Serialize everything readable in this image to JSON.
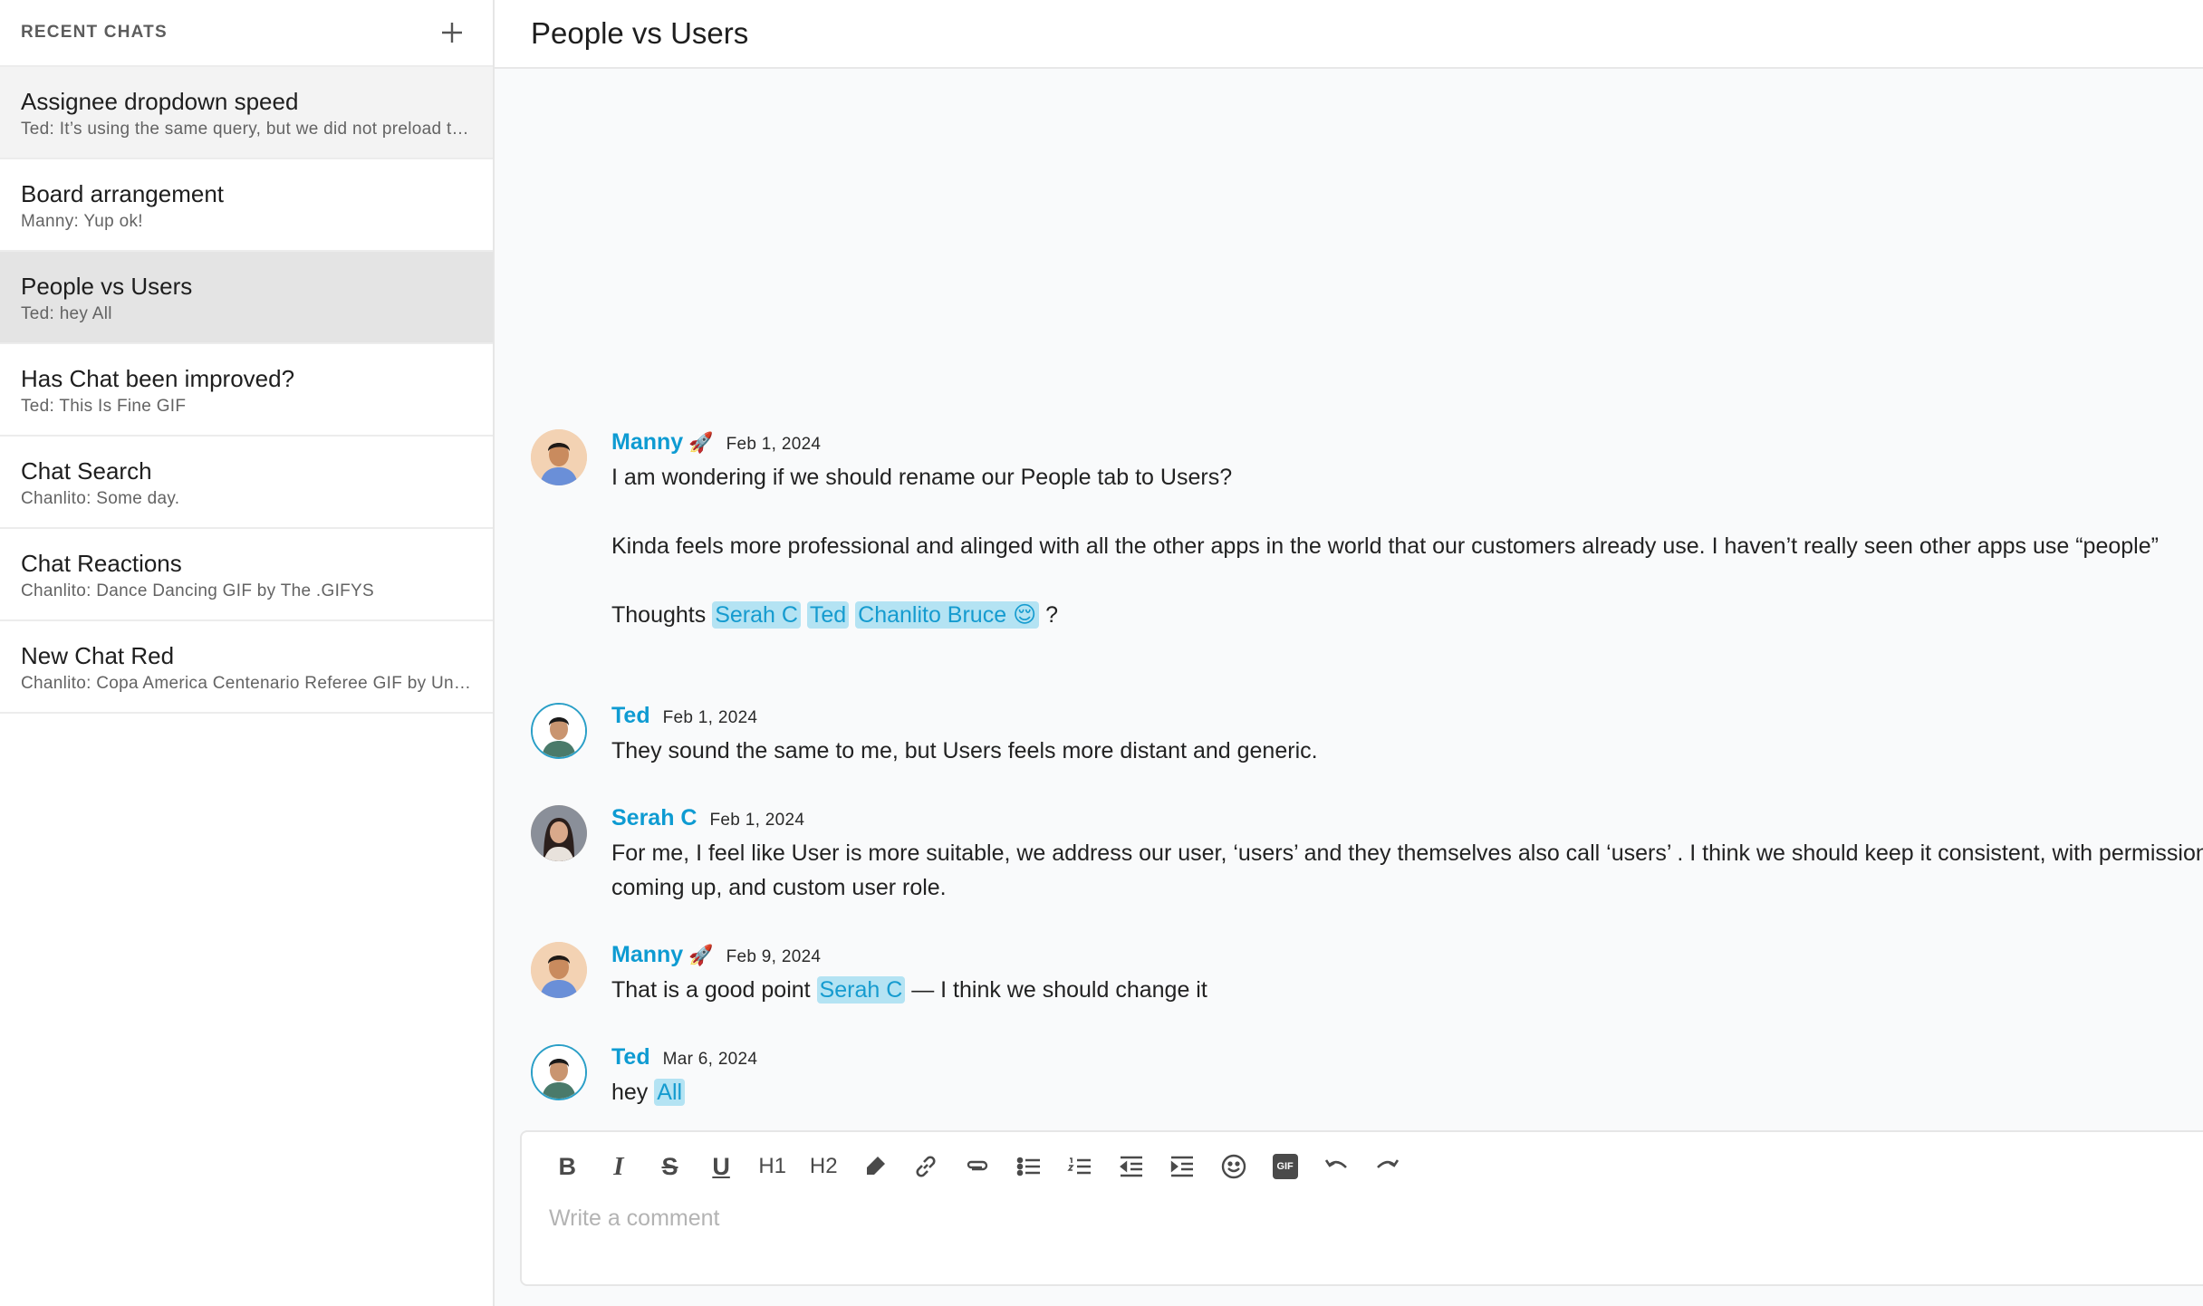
{
  "sidebar": {
    "title": "RECENT CHATS",
    "add_icon": "plus-icon",
    "chats": [
      {
        "name": "Assignee dropdown speed",
        "preview": "Ted: It’s using the same query, but we did not preload the data"
      },
      {
        "name": "Board arrangement",
        "preview": "Manny: Yup ok!"
      },
      {
        "name": "People vs Users",
        "preview": "Ted: hey All"
      },
      {
        "name": "Has Chat been improved?",
        "preview": "Ted: This Is Fine GIF"
      },
      {
        "name": "Chat Search",
        "preview": "Chanlito: Some day."
      },
      {
        "name": "Chat Reactions",
        "preview": "Chanlito: Dance Dancing GIF by The .GIFYS"
      },
      {
        "name": "New Chat Red",
        "preview": "Chanlito: Copa America Centenario Referee GIF by Univision Deportes"
      }
    ],
    "active_index": 2,
    "hover_index": 0
  },
  "header": {
    "title": "People vs Users"
  },
  "messages": [
    {
      "author": "Manny",
      "emoji": "🚀",
      "date": "Feb 1, 2024",
      "line1": "I am wondering if we should rename our People tab to Users?",
      "line2": "Kinda feels more professional and alinged with all the other apps in the world that our customers already use. I haven’t really seen other apps use “people”",
      "line3_prefix": "Thoughts",
      "mentions": [
        "Serah C",
        "Ted",
        "Chanlito Bruce 😌"
      ],
      "line3_suffix": "?"
    },
    {
      "author": "Ted",
      "date": "Feb 1, 2024",
      "line1": "They sound the same to me, but Users feels more distant and generic."
    },
    {
      "author": "Serah C",
      "date": "Feb 1, 2024",
      "line1": "For me, I feel like User is more suitable, we address our user, ‘users’ and they themselves also call ‘users’ . I think we should keep it consistent, with permissions",
      "line2": "coming up, and custom user role."
    },
    {
      "author": "Manny",
      "emoji": "🚀",
      "date": "Feb 9, 2024",
      "prefix": "That is a good point",
      "mention": "Serah C",
      "suffix": "— I think we should change it"
    },
    {
      "author": "Ted",
      "date": "Mar 6, 2024",
      "prefix": "hey",
      "mention": "All"
    }
  ],
  "editor": {
    "placeholder": "Write a comment",
    "value": "",
    "toolbar": [
      {
        "icon": "bold-icon",
        "label": "B"
      },
      {
        "icon": "italic-icon",
        "label": "I"
      },
      {
        "icon": "strikethrough-icon",
        "label": "S"
      },
      {
        "icon": "underline-icon",
        "label": "U"
      },
      {
        "icon": "heading1-icon",
        "label": "H1"
      },
      {
        "icon": "heading2-icon",
        "label": "H2"
      },
      {
        "icon": "highlighter-icon"
      },
      {
        "icon": "link-icon"
      },
      {
        "icon": "attachment-icon"
      },
      {
        "icon": "bullet-list-icon"
      },
      {
        "icon": "numbered-list-icon"
      },
      {
        "icon": "outdent-icon"
      },
      {
        "icon": "indent-icon"
      },
      {
        "icon": "emoji-icon"
      },
      {
        "icon": "gif-icon",
        "label": "GIF"
      },
      {
        "icon": "undo-icon"
      },
      {
        "icon": "redo-icon"
      }
    ]
  },
  "colors": {
    "author": "#0e9bd2",
    "mention_bg": "#b4e3f3",
    "active_chat": "#e4e4e4"
  }
}
